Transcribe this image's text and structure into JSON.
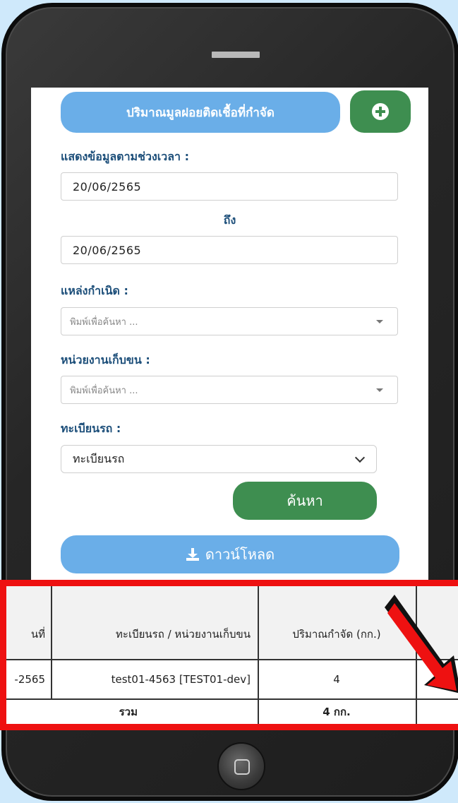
{
  "form": {
    "title_button": "ปริมาณมูลฝอยติดเชื้อที่กำจัด",
    "date_range_label": "แสดงข้อมูลตามช่วงเวลา :",
    "date_from": "20/06/2565",
    "to_label": "ถึง",
    "date_to": "20/06/2565",
    "origin_label": "แหล่งกำเนิด :",
    "origin_placeholder": "พิมพ์เพื่อค้นหา ...",
    "collector_label": "หน่วยงานเก็บขน :",
    "collector_placeholder": "พิมพ์เพื่อค้นหา ...",
    "plate_label": "ทะเบียนรถ :",
    "plate_selected": "ทะเบียนรถ",
    "search_button": "ค้นหา",
    "download_button": "ดาวน์โหลด"
  },
  "table": {
    "headers": [
      "นที่",
      "ทะเบียนรถ / หน่วยงานเก็บขน",
      "ปริมาณกำจัด (กก.)",
      "ร"
    ],
    "rows": [
      [
        "-2565",
        "test01-4563 [TEST01-dev]",
        "4",
        ""
      ]
    ],
    "total_label": "รวม",
    "total_value": "4 กก."
  },
  "colors": {
    "accent_blue": "#6aaee8",
    "accent_green": "#3e8e50",
    "label_blue": "#1d4f7a",
    "highlight_red": "#ee1111"
  },
  "icons": {
    "add": "plus-circle-icon",
    "download": "download-icon",
    "annotation": "red-arrow-icon"
  }
}
